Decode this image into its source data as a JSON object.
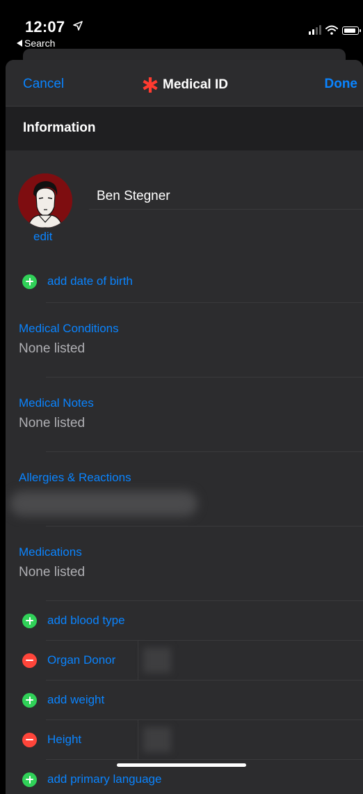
{
  "status_bar": {
    "time": "12:07",
    "back_label": "Search"
  },
  "navbar": {
    "cancel": "Cancel",
    "title": "Medical ID",
    "done": "Done"
  },
  "section": {
    "title": "Information"
  },
  "profile": {
    "name": "Ben Stegner",
    "edit": "edit"
  },
  "dob": {
    "label": "add date of birth"
  },
  "fields": {
    "conditions": {
      "label": "Medical Conditions",
      "value": "None listed"
    },
    "notes": {
      "label": "Medical Notes",
      "value": "None listed"
    },
    "allergies": {
      "label": "Allergies & Reactions"
    },
    "medications": {
      "label": "Medications",
      "value": "None listed"
    }
  },
  "rows": {
    "blood_type": "add blood type",
    "organ_donor": "Organ Donor",
    "weight": "add weight",
    "height": "Height",
    "language": "add primary language"
  },
  "colors": {
    "accent": "#0a84ff",
    "add": "#30d158",
    "remove": "#ff453a",
    "asterisk": "#ff3b30"
  }
}
